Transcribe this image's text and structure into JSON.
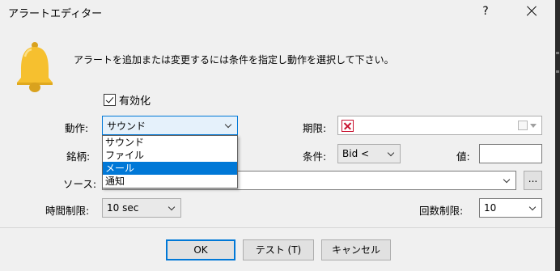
{
  "window": {
    "title": "アラートエディター",
    "help": "?"
  },
  "description": "アラートを追加または変更するには条件を指定し動作を選択して下さい。",
  "enabled": {
    "label": "有効化",
    "checked": true
  },
  "action": {
    "label": "動作:",
    "value": "サウンド",
    "options": [
      "サウンド",
      "ファイル",
      "メール",
      "通知"
    ],
    "highlighted": "メール"
  },
  "expiry": {
    "label": "期限:"
  },
  "symbol": {
    "label": "銘柄:"
  },
  "condition": {
    "label": "条件:",
    "value": "Bid <"
  },
  "value_field": {
    "label": "値:",
    "value": ""
  },
  "source": {
    "label": "ソース:",
    "value": "",
    "browse": "..."
  },
  "time_limit": {
    "label": "時間制限:",
    "value": "10 sec"
  },
  "count_limit": {
    "label": "回数制限:",
    "value": "10"
  },
  "buttons": {
    "ok": "OK",
    "test": "テスト (T)",
    "cancel": "キャンセル"
  },
  "colors": {
    "accent": "#0078d7",
    "bell": "#f6c02f",
    "error": "#c8102e"
  }
}
